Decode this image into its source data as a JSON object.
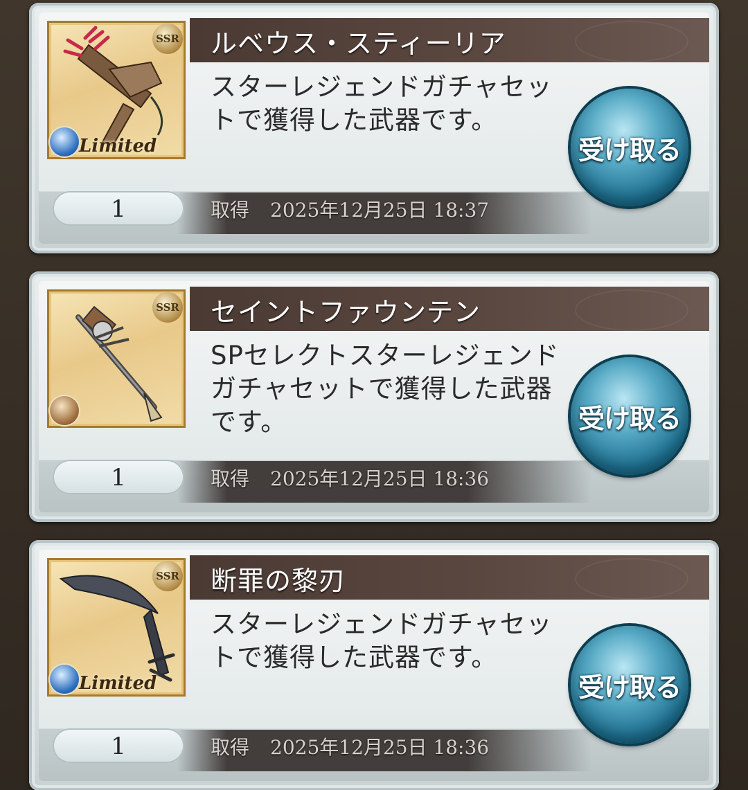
{
  "items": [
    {
      "name": "ルベウス・スティーリア",
      "description": "スターレジェンドガチャセットで獲得した武器です。",
      "quantity": "1",
      "obtained_label": "取得",
      "obtained_date": "2025年12月25日 18:37",
      "rarity": "SSR",
      "limited": "Limited",
      "element_icon": "water-element-icon",
      "button_label": "受け取る"
    },
    {
      "name": "セイントファウンテン",
      "description": "SPセレクトスターレジェンドガチャセットで獲得した武器です。",
      "quantity": "1",
      "obtained_label": "取得",
      "obtained_date": "2025年12月25日 18:36",
      "rarity": "SSR",
      "limited": "",
      "element_icon": "light-element-icon",
      "button_label": "受け取る"
    },
    {
      "name": "断罪の黎刃",
      "description": "スターレジェンドガチャセットで獲得した武器です。",
      "quantity": "1",
      "obtained_label": "取得",
      "obtained_date": "2025年12月25日 18:36",
      "rarity": "SSR",
      "limited": "Limited",
      "element_icon": "water-element-icon",
      "button_label": "受け取る"
    }
  ],
  "colors": {
    "title_bar": "#4a3a33",
    "button": "#1d6f8f",
    "background": "#3a3128"
  }
}
